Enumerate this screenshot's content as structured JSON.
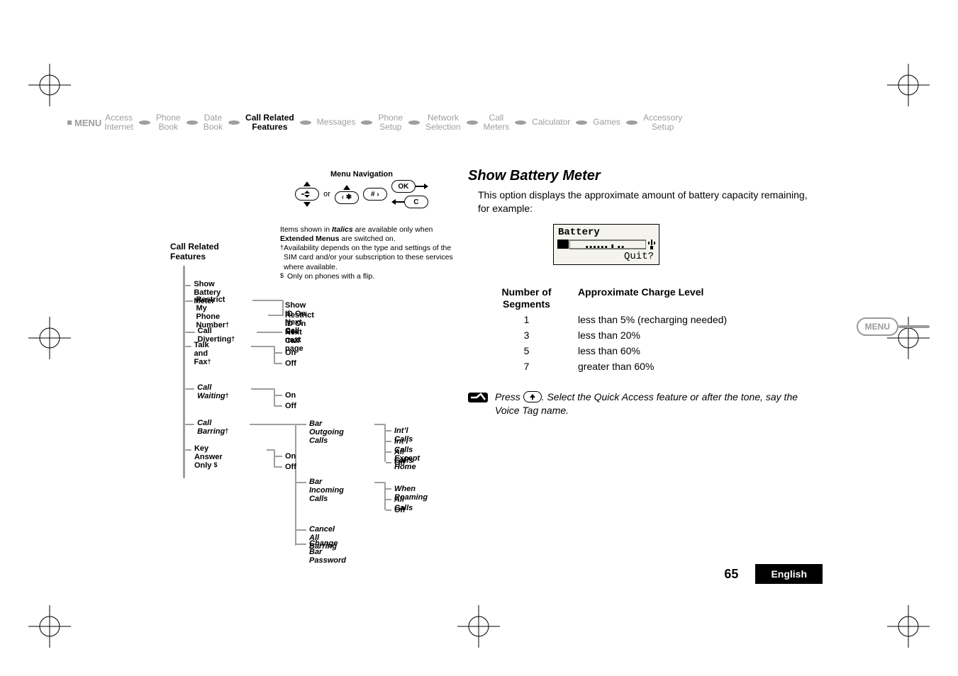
{
  "topbar": {
    "menu_label": "MENU",
    "nodes": [
      {
        "line1": "Access",
        "line2": "Internet"
      },
      {
        "line1": "Phone",
        "line2": "Book"
      },
      {
        "line1": "Date",
        "line2": "Book"
      },
      {
        "line1": "Call Related",
        "line2": "Features",
        "highlight": true
      },
      {
        "line1": "Messages",
        "line2": ""
      },
      {
        "line1": "Phone",
        "line2": "Setup"
      },
      {
        "line1": "Network",
        "line2": "Selection"
      },
      {
        "line1": "Call",
        "line2": "Meters"
      },
      {
        "line1": "Calculator",
        "line2": ""
      },
      {
        "line1": "Games",
        "line2": ""
      },
      {
        "line1": "Accessory",
        "line2": "Setup"
      }
    ]
  },
  "menu_nav": {
    "title": "Menu Navigation",
    "or": "or",
    "ok": "OK",
    "c": "C",
    "star": "‹ ✱",
    "hash": "# ›"
  },
  "notes": {
    "line1a": "Items shown in ",
    "line1b": "Italics",
    "line1c": " are available only when ",
    "line1d": "Extended Menus",
    "line1e": " are switched on.",
    "dagger": "†",
    "dagger_text": " Availability depends on the type and settings of the SIM card and/or your subscription to these services where available.",
    "dollar": "$",
    "dollar_text": " Only on phones with a flip."
  },
  "crf": {
    "label_l1": "Call Related",
    "label_l2": "Features",
    "items": {
      "show_battery": "Show Battery Meter",
      "restrict_l1": "Restrict My",
      "restrict_l2": "Phone Number",
      "restrict_sub1": "Show ID On Next Call",
      "restrict_sub2": "Restrict ID On Next Call",
      "diverting": "Call Diverting",
      "diverting_sub": "See next page",
      "talkfax": "Talk and Fax",
      "on": "On",
      "off": "Off",
      "waiting": "Call Waiting",
      "barring": "Call Barring",
      "key_answer": "Key Answer Only ",
      "bar_out": "Bar Outgoing Calls",
      "bar_out_sub1": "Int’l Calls",
      "bar_out_sub2": "Int’l Calls Except Home",
      "bar_out_sub3": "All Calls",
      "bar_out_sub4": "Off",
      "bar_in": "Bar Incoming Calls",
      "bar_in_sub1": "When Roaming",
      "bar_in_sub2": "All Calls",
      "bar_in_sub3": "Off",
      "cancel_all": "Cancel All Barring",
      "change_pw": "Change Bar Password"
    },
    "dagger": "†",
    "dollar": "$"
  },
  "right": {
    "heading": "Show Battery Meter",
    "desc": "This option displays the approximate amount of battery capacity remaining, for example:",
    "lcd": {
      "row1": "Battery",
      "row3": "Quit?"
    },
    "table": {
      "head1_l1": "Number of",
      "head1_l2": "Segments",
      "head2": "Approximate Charge Level",
      "rows": [
        {
          "n": "1",
          "desc": "less than 5% (recharging needed)"
        },
        {
          "n": "3",
          "desc": "less than 20%"
        },
        {
          "n": "5",
          "desc": "less than 60%"
        },
        {
          "n": "7",
          "desc": "greater than 60%"
        }
      ]
    },
    "tip_a": "Press ",
    "tip_b": ". Select the Quick Access feature or after the tone, say the Voice Tag name.",
    "tip_btn": "↑"
  },
  "side_tab": "MENU",
  "footer": {
    "page": "65",
    "lang": "English"
  }
}
